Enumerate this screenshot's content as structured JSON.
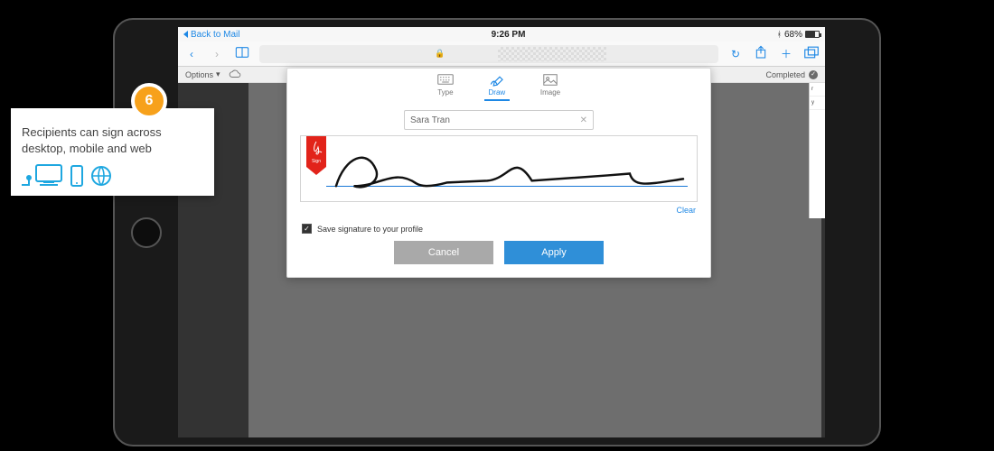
{
  "status": {
    "back_label": "Back to Mail",
    "time": "9:26 PM",
    "battery": "68%"
  },
  "app": {
    "options_label": "Options",
    "completed_label": "Completed"
  },
  "tabs": {
    "type": "Type",
    "draw": "Draw",
    "image": "Image"
  },
  "signature": {
    "name_value": "Sara Tran",
    "clear_label": "Clear",
    "save_label": "Save signature to your profile",
    "cancel_label": "Cancel",
    "apply_label": "Apply"
  },
  "callout": {
    "step": "6",
    "text": "Recipients can sign across desktop, mobile and web"
  }
}
